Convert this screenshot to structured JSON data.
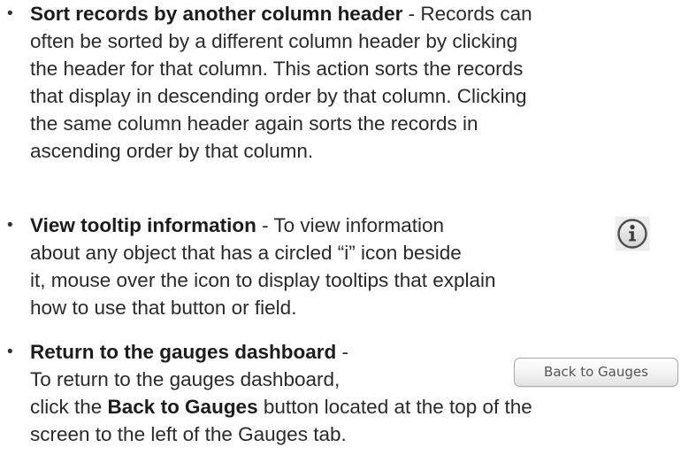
{
  "bullet": "•",
  "items": [
    {
      "title": "Sort records by another column header",
      "sep": " - ",
      "lines": [
        "Records can",
        "often be sorted by a different column header by clicking",
        "the header for that column. This action sorts the records",
        "that display in descending order by that column. Clicking",
        "the same column header again sorts the records in",
        "ascending order by that column."
      ]
    },
    {
      "title": "View tooltip information",
      "sep": " - ",
      "lines": [
        "To view information",
        "about any object that has a circled “i” icon beside",
        "it, mouse over the icon to display tooltips that explain",
        "how to use that button or field."
      ],
      "icon": "info-circle-icon"
    },
    {
      "title": "Return to the gauges dashboard",
      "sep": " -",
      "lines": [
        "To return to the gauges dashboard,",
        "click the ",
        " button located at the top of the",
        "screen to the left of the Gauges tab."
      ],
      "button_ref": "Back to Gauges",
      "button_label": "Back to Gauges"
    }
  ]
}
